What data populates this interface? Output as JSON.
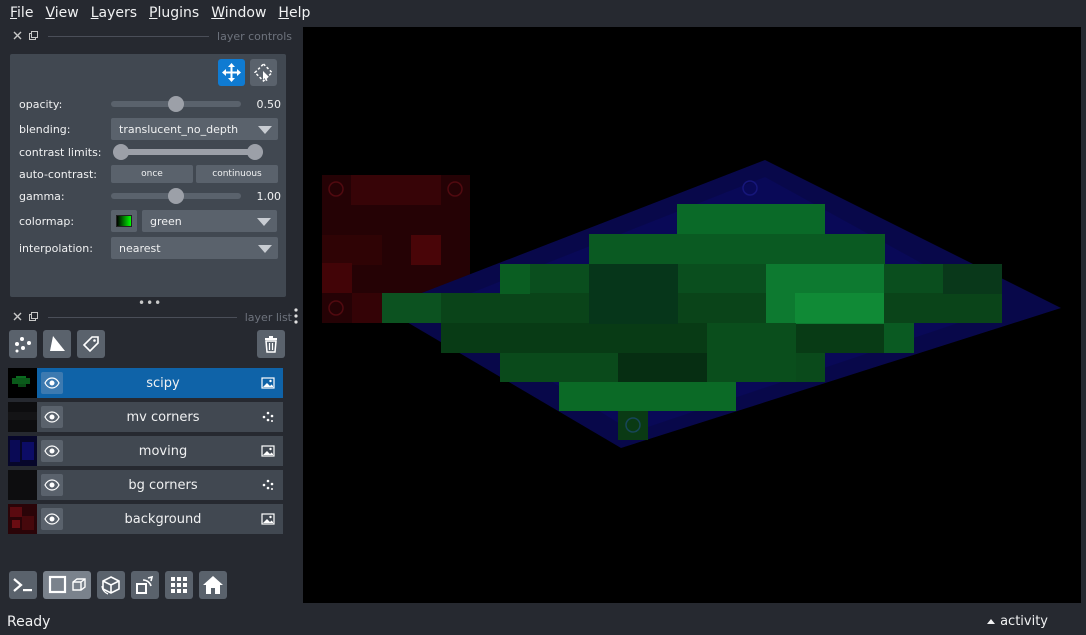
{
  "menu": [
    {
      "underline": "F",
      "rest": "ile"
    },
    {
      "underline": "V",
      "rest": "iew"
    },
    {
      "underline": "L",
      "rest": "ayers"
    },
    {
      "underline": "P",
      "rest": "lugins"
    },
    {
      "underline": "W",
      "rest": "indow"
    },
    {
      "underline": "H",
      "rest": "elp"
    }
  ],
  "dock": {
    "controls_title": "layer controls",
    "list_title": "layer list"
  },
  "controls": {
    "opacity": {
      "label": "opacity:",
      "value": 0.5,
      "value_text": "0.50"
    },
    "blending": {
      "label": "blending:",
      "value": "translucent_no_depth"
    },
    "contrast": {
      "label": "contrast limits:",
      "low": 0.0,
      "high": 1.0
    },
    "auto_contrast": {
      "label": "auto-contrast:",
      "once": "once",
      "continuous": "continuous"
    },
    "gamma": {
      "label": "gamma:",
      "value": 1.0,
      "value_text": "1.00"
    },
    "colormap": {
      "label": "colormap:",
      "value": "green",
      "swatch_color": "#00ff00"
    },
    "interpolation": {
      "label": "interpolation:",
      "value": "nearest"
    }
  },
  "layers": [
    {
      "name": "scipy",
      "type": "image",
      "selected": true
    },
    {
      "name": "mv corners",
      "type": "points",
      "selected": false
    },
    {
      "name": "moving",
      "type": "image",
      "selected": false
    },
    {
      "name": "bg corners",
      "type": "points",
      "selected": false
    },
    {
      "name": "background",
      "type": "image",
      "selected": false
    }
  ],
  "status": {
    "text": "Ready",
    "activity": "activity"
  },
  "colors": {
    "accent": "#0f7bd2",
    "panel": "#414851",
    "background": "#262930"
  }
}
